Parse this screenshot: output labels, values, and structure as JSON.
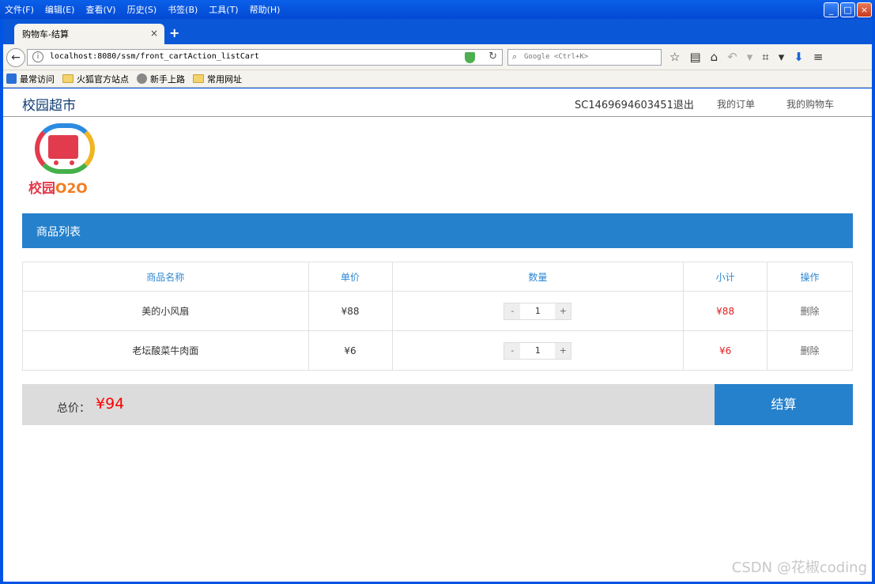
{
  "browser": {
    "menu": [
      "文件(F)",
      "编辑(E)",
      "查看(V)",
      "历史(S)",
      "书签(B)",
      "工具(T)",
      "帮助(H)"
    ],
    "tab_title": "购物车-结算",
    "tab_close": "×",
    "new_tab": "+",
    "url": "localhost:8080/ssm/front_cartAction_listCart",
    "search_placeholder": "Google <Ctrl+K>",
    "bookmarks": [
      "最常访问",
      "火狐官方站点",
      "新手上路",
      "常用网址"
    ],
    "window_controls": [
      "minimize-icon",
      "maximize-icon",
      "close-icon"
    ]
  },
  "site": {
    "brand": "校园超市",
    "user_id": "SC1469694603451",
    "logout": "退出",
    "nav_orders": "我的订单",
    "nav_cart": "我的购物车",
    "logo_text_cn": "校园",
    "logo_text_o2o": "O2O"
  },
  "cart": {
    "section_title": "商品列表",
    "headers": [
      "商品名称",
      "单价",
      "数量",
      "小计",
      "操作"
    ],
    "rows": [
      {
        "name": "美的小风扇",
        "price": "¥88",
        "qty": "1",
        "subtotal": "¥88",
        "action": "删除"
      },
      {
        "name": "老坛酸菜牛肉面",
        "price": "¥6",
        "qty": "1",
        "subtotal": "¥6",
        "action": "删除"
      }
    ],
    "minus": "-",
    "plus": "+",
    "total_label": "总价：",
    "total_value": "¥94",
    "checkout": "结算"
  },
  "watermark": "CSDN @花椒coding",
  "colors": {
    "accent": "#2581cc",
    "price_red": "#e02020",
    "brand_text": "#0e3b73"
  }
}
